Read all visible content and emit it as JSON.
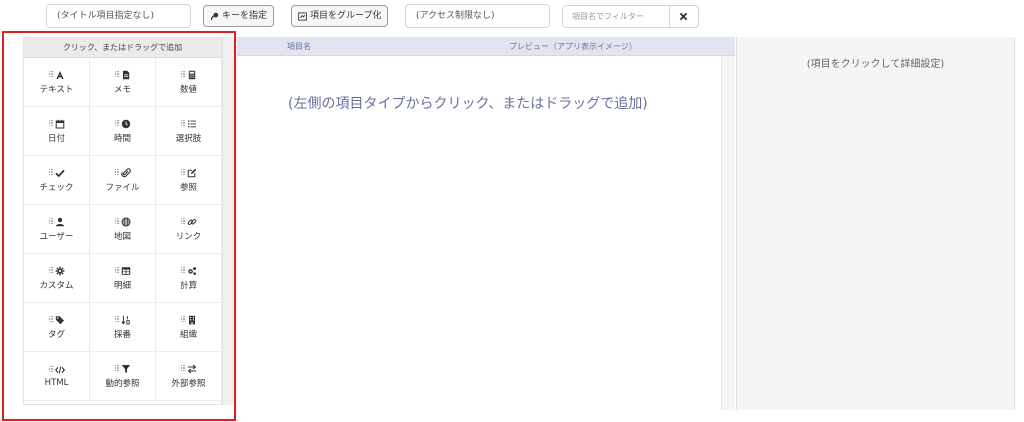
{
  "toolbar": {
    "title_field": "(タイトル項目指定なし)",
    "key_button": "キーを指定",
    "group_button": "項目をグループ化",
    "access_field": "(アクセス制限なし)",
    "filter_placeholder": "項目名でフィルター"
  },
  "palette": {
    "header": "クリック、またはドラッグで追加",
    "items": [
      {
        "label": "テキスト",
        "icon": "text-icon"
      },
      {
        "label": "メモ",
        "icon": "memo-icon"
      },
      {
        "label": "数値",
        "icon": "calculator-icon"
      },
      {
        "label": "日付",
        "icon": "calendar-icon"
      },
      {
        "label": "時間",
        "icon": "clock-icon"
      },
      {
        "label": "選択肢",
        "icon": "list-icon"
      },
      {
        "label": "チェック",
        "icon": "check-icon"
      },
      {
        "label": "ファイル",
        "icon": "paperclip-icon"
      },
      {
        "label": "参照",
        "icon": "edit-reference-icon"
      },
      {
        "label": "ユーザー",
        "icon": "user-icon"
      },
      {
        "label": "地図",
        "icon": "globe-icon"
      },
      {
        "label": "リンク",
        "icon": "link-icon"
      },
      {
        "label": "カスタム",
        "icon": "gear-icon"
      },
      {
        "label": "明細",
        "icon": "table-icon"
      },
      {
        "label": "計算",
        "icon": "gears-icon"
      },
      {
        "label": "タグ",
        "icon": "tags-icon"
      },
      {
        "label": "採番",
        "icon": "sort-numeric-icon"
      },
      {
        "label": "組織",
        "icon": "building-icon"
      },
      {
        "label": "HTML",
        "icon": "code-icon"
      },
      {
        "label": "動的参照",
        "icon": "filter-icon"
      },
      {
        "label": "外部参照",
        "icon": "exchange-icon"
      }
    ]
  },
  "center": {
    "col_name": "項目名",
    "col_preview": "プレビュー（アプリ表示イメージ）",
    "drop_hint": "(左側の項目タイプからクリック、またはドラッグで追加)"
  },
  "detail": {
    "hint": "(項目をクリックして詳細設定)"
  },
  "colors": {
    "highlight": "#e02020",
    "accent": "#6b6f9e",
    "header_bg": "#e2e4f0"
  }
}
